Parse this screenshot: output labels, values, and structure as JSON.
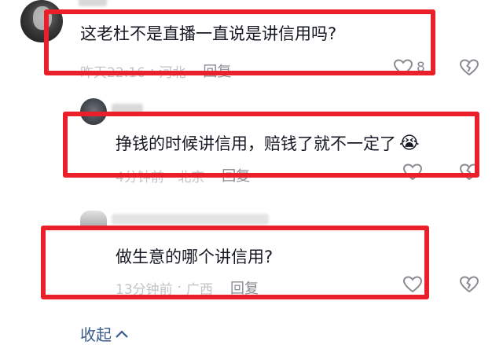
{
  "comments": [
    {
      "text": "这老杜不是直播一直说是讲信用吗?",
      "time": "昨天22:16",
      "location": "河北",
      "reply_label": "回复",
      "like_count": "8"
    },
    {
      "text": "挣钱的时候讲信用，赔钱了就不一定了",
      "emoji": "😭",
      "time": "4分钟前",
      "location": "北京",
      "reply_label": "回复"
    },
    {
      "text": "做生意的哪个讲信用?",
      "time": "13分钟前",
      "location": "广西",
      "reply_label": "回复"
    }
  ],
  "separator": "·",
  "collapse_label": "收起",
  "colors": {
    "highlight": "#ea1f29",
    "meta": "#c2c3c6",
    "collapse": "#3a5a8c"
  },
  "icons": [
    "heart-outline-icon",
    "broken-heart-icon",
    "chevron-up-icon"
  ]
}
